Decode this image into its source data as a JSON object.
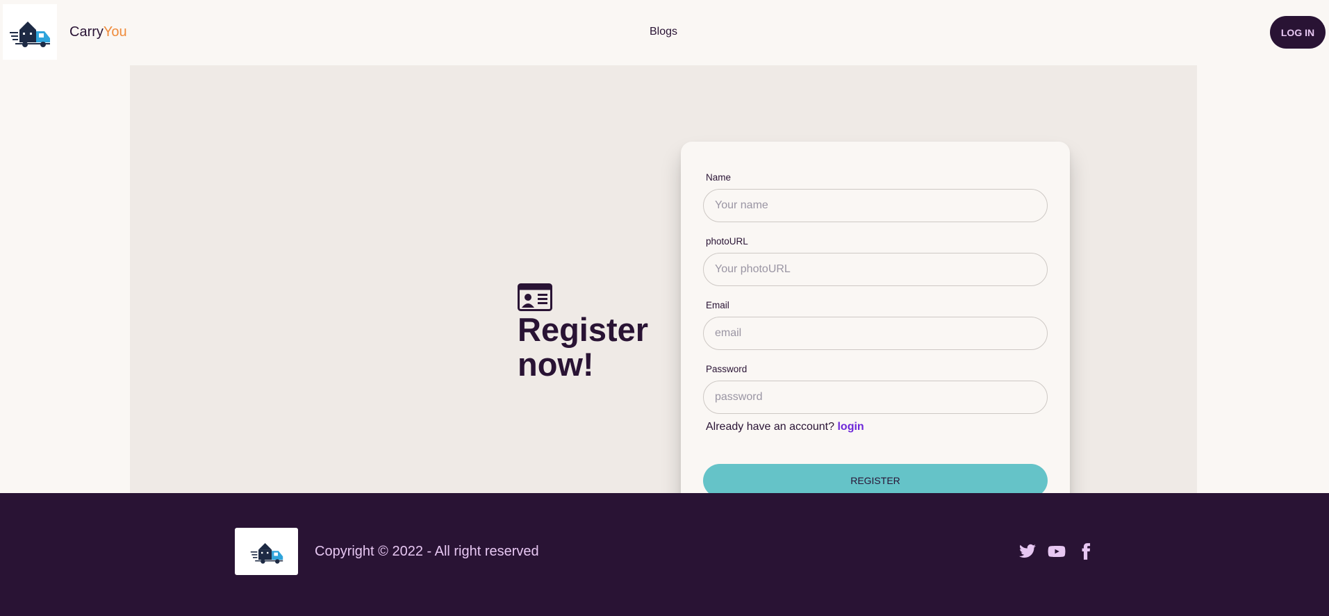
{
  "header": {
    "brand_main": "Carry",
    "brand_accent": "You",
    "nav_blogs": "Blogs",
    "login_label": "LOG IN"
  },
  "hero": {
    "title": "Register now!"
  },
  "form": {
    "name_label": "Name",
    "name_placeholder": "Your name",
    "photo_label": "photoURL",
    "photo_placeholder": "Your photoURL",
    "email_label": "Email",
    "email_placeholder": "email",
    "password_label": "Password",
    "password_placeholder": "password",
    "account_prompt": "Already have an account? ",
    "login_link": "login",
    "register_label": "REGISTER"
  },
  "footer": {
    "copyright": "Copyright © 2022 - All right reserved",
    "socials": [
      "twitter-icon",
      "youtube-icon",
      "facebook-icon"
    ]
  },
  "colors": {
    "primary": "#291334",
    "accent": "#ef8b3b",
    "secondary": "#65c3c8",
    "link": "#6d28d9",
    "background": "#faf7f4",
    "hero_bg": "#efeae6"
  }
}
